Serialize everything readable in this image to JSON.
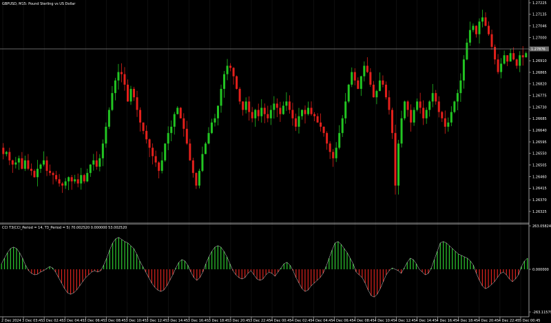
{
  "window_title": "GBPUSD, M15: Pound Sterling vs US Dollar",
  "indicator_title": "CCI T3(CCI_Period = 14, T3_Period = 5) 70.002520 0.000000 53.002520",
  "current_price": "1.27876",
  "colors": {
    "background": "#000000",
    "grid": "#1e1e1e",
    "axis": "#c8c8c8",
    "bull": "#22c522",
    "bear": "#e3201b",
    "price_label_bg": "#6b6b6b",
    "indicator_up": "#2ecc30",
    "indicator_down": "#e0241f"
  },
  "price_axis": {
    "labels": [
      "1.27225",
      "1.27135",
      "1.27046",
      "1.27000",
      "1.26955",
      "1.26910",
      "1.26865",
      "1.26820",
      "1.26775",
      "1.26730",
      "1.26685",
      "1.26640",
      "1.26595",
      "1.26550",
      "1.26505",
      "1.26460",
      "1.26415",
      "1.26370",
      "1.26325"
    ]
  },
  "indicator_axis": {
    "labels": [
      "263.0582466",
      "0.000000",
      "-263.1157976"
    ]
  },
  "time_axis": {
    "labels": [
      "2 Dec 2024",
      "3 Dec 03:45",
      "3 Dec 02:45",
      "3 Dec 04:45",
      "3 Dec 06:45",
      "3 Dec 08:45",
      "3 Dec 10:45",
      "3 Dec 12:45",
      "3 Dec 14:45",
      "3 Dec 16:45",
      "3 Dec 18:45",
      "3 Dec 20:45",
      "3 Dec 22:45",
      "4 Dec 00:45",
      "4 Dec 02:45",
      "4 Dec 04:45",
      "4 Dec 06:45",
      "4 Dec 08:45",
      "4 Dec 10:45",
      "4 Dec 12:45",
      "4 Dec 14:45",
      "4 Dec 16:45",
      "4 Dec 18:45",
      "4 Dec 20:45",
      "4 Dec 22:45",
      "5 Dec 00:45"
    ]
  },
  "chart_data": {
    "type": "candlestick",
    "instrument": "GBPUSD",
    "timeframe": "M15",
    "ylim": [
      1.263,
      1.2725
    ],
    "price_path": [
      1.2658,
      1.2655,
      1.2656,
      1.2652,
      1.265,
      1.2651,
      1.2653,
      1.2648,
      1.2652,
      1.2648,
      1.2647,
      1.2644,
      1.2648,
      1.265,
      1.2652,
      1.2647,
      1.2646,
      1.2645,
      1.2643,
      1.2641,
      1.264,
      1.2642,
      1.2644,
      1.2642,
      1.2643,
      1.2641,
      1.2645,
      1.2642,
      1.2646,
      1.265,
      1.2652,
      1.2649,
      1.2653,
      1.266,
      1.2668,
      1.2676,
      1.2684,
      1.269,
      1.2694,
      1.2693,
      1.2688,
      1.268,
      1.2686,
      1.2682,
      1.2676,
      1.267,
      1.2666,
      1.2662,
      1.2658,
      1.2654,
      1.2651,
      1.2647,
      1.2652,
      1.266,
      1.2665,
      1.2668,
      1.2674,
      1.2677,
      1.2672,
      1.2667,
      1.266,
      1.2652,
      1.2646,
      1.264,
      1.2647,
      1.2655,
      1.266,
      1.2665,
      1.267,
      1.2672,
      1.2678,
      1.2686,
      1.2693,
      1.2697,
      1.2696,
      1.2692,
      1.2686,
      1.268,
      1.2676,
      1.268,
      1.2675,
      1.2672,
      1.2676,
      1.2673,
      1.2677,
      1.2674,
      1.2672,
      1.2676,
      1.2679,
      1.2677,
      1.2674,
      1.2678,
      1.268,
      1.2676,
      1.2672,
      1.2668,
      1.2673,
      1.2676,
      1.2674,
      1.2677,
      1.2674,
      1.2673,
      1.267,
      1.2668,
      1.2665,
      1.266,
      1.2656,
      1.2653,
      1.2658,
      1.2665,
      1.2672,
      1.268,
      1.2688,
      1.2694,
      1.269,
      1.2686,
      1.2692,
      1.2697,
      1.2694,
      1.2688,
      1.2682,
      1.2685,
      1.269,
      1.2688,
      1.2682,
      1.2676,
      1.2665,
      1.264,
      1.266,
      1.2672,
      1.268,
      1.2676,
      1.267,
      1.2676,
      1.268,
      1.2677,
      1.2672,
      1.2676,
      1.268,
      1.2684,
      1.268,
      1.2675,
      1.2672,
      1.2668,
      1.267,
      1.2675,
      1.268,
      1.2684,
      1.269,
      1.27,
      1.2708,
      1.2714,
      1.2716,
      1.2712,
      1.2718,
      1.272,
      1.2716,
      1.2712,
      1.2706,
      1.27,
      1.2694,
      1.2698,
      1.2702,
      1.2699,
      1.2703,
      1.27,
      1.2697,
      1.2702,
      1.2701,
      1.2703
    ],
    "cci_t3": [
      40,
      80,
      120,
      150,
      160,
      150,
      120,
      80,
      30,
      -10,
      -30,
      -40,
      -35,
      -20,
      -10,
      5,
      20,
      10,
      -20,
      -60,
      -100,
      -140,
      -170,
      -180,
      -170,
      -150,
      -120,
      -90,
      -60,
      -40,
      -20,
      -10,
      -20,
      -10,
      30,
      80,
      140,
      190,
      220,
      230,
      215,
      200,
      190,
      170,
      150,
      110,
      60,
      20,
      -20,
      -60,
      -100,
      -130,
      -150,
      -160,
      -150,
      -120,
      -80,
      -40,
      10,
      50,
      70,
      60,
      30,
      -20,
      -60,
      -80,
      -60,
      -20,
      40,
      90,
      130,
      160,
      170,
      160,
      130,
      90,
      40,
      -10,
      -40,
      -60,
      -70,
      -60,
      -30,
      -10,
      -40,
      -70,
      -80,
      -70,
      -40,
      -20,
      -30,
      -50,
      -20,
      10,
      40,
      50,
      30,
      -10,
      -60,
      -100,
      -140,
      -160,
      -150,
      -120,
      -100,
      -80,
      -60,
      -30,
      20,
      80,
      140,
      190,
      200,
      180,
      150,
      120,
      80,
      40,
      -20,
      -40,
      -60,
      -100,
      -150,
      -190,
      -200,
      -180,
      -140,
      -90,
      -40,
      -10,
      10,
      0,
      -10,
      -30,
      10,
      50,
      80,
      70,
      40,
      0,
      -20,
      -40,
      -30,
      10,
      70,
      130,
      190,
      200,
      190,
      170,
      150,
      130,
      110,
      100,
      90,
      80,
      60,
      30,
      -30,
      -80,
      -120,
      -140,
      -130,
      -110,
      -90,
      -60,
      -30,
      -20,
      -40,
      -70,
      -90,
      -70,
      -40,
      20,
      60,
      80
    ]
  }
}
